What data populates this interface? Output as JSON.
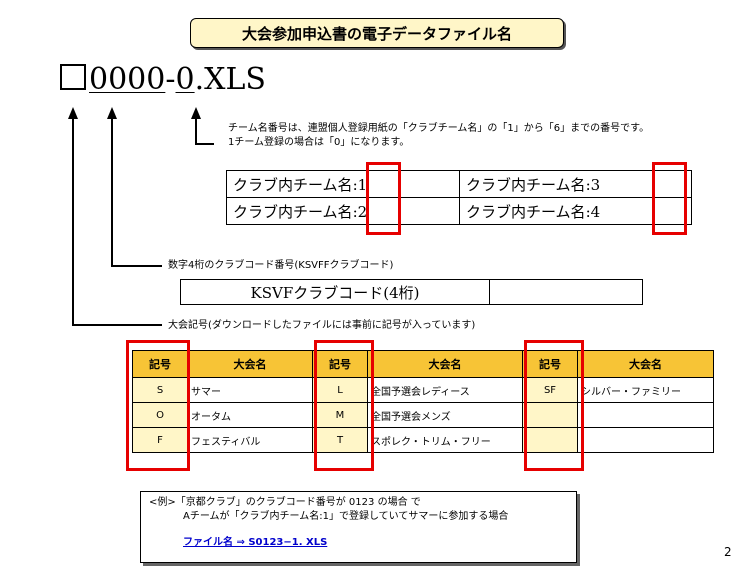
{
  "title": "大会参加申込書の電子データファイル名",
  "filename": {
    "code": "0000",
    "sep": "-",
    "team": "0",
    "ext": ".XLS"
  },
  "notes": {
    "team_line1": "チーム名番号は、連盟個人登録用紙の「クラブチーム名」の「1」から「6」までの番号です。",
    "team_line2": "1チーム登録の場合は「0」になります。",
    "club_code": "数字4桁のクラブコード番号(KSVFFクラブコード)",
    "meet_code": "大会記号(ダウンロードしたファイルには事前に記号が入っています)"
  },
  "team_labels": [
    {
      "text": "クラブ内チーム名",
      "num": ":1"
    },
    {
      "text": "クラブ内チーム名",
      "num": ":3"
    },
    {
      "text": "クラブ内チーム名",
      "num": ":2"
    },
    {
      "text": "クラブ内チーム名",
      "num": ":4"
    }
  ],
  "ksvf_label": "KSVFクラブコード(4桁)",
  "meet_table": {
    "headers": [
      "記号",
      "大会名",
      "記号",
      "大会名",
      "記号",
      "大会名"
    ],
    "rows": [
      [
        "S",
        "サマー",
        "L",
        "全国予選会レディース",
        "SF",
        "シルバー・ファミリー"
      ],
      [
        "O",
        "オータム",
        "M",
        "全国予選会メンズ",
        "",
        ""
      ],
      [
        "F",
        "フェスティバル",
        "T",
        "スポレク・トリム・フリー",
        "",
        ""
      ]
    ]
  },
  "example": {
    "line1": "<例>「京都クラブ」のクラブコード番号が 0123 の場合 で",
    "line2": "Aチームが「クラブ内チーム名:1」で登録していてサマーに参加する場合",
    "link": "ファイル名 ⇒ S0123−1. XLS"
  },
  "page_number": "2",
  "colors": {
    "header_fill": "#f7c436",
    "highlight": "#e60000",
    "title_fill": "#fff6c8"
  }
}
